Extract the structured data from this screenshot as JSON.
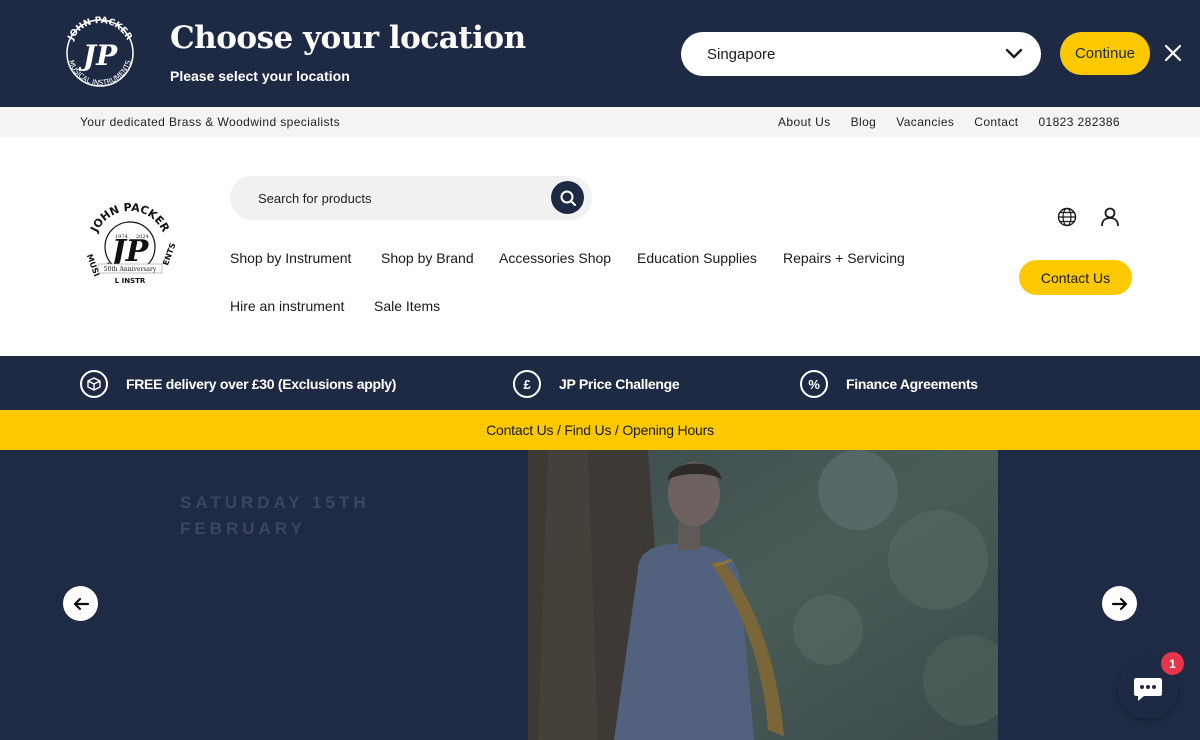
{
  "location_banner": {
    "title": "Choose your location",
    "subtitle": "Please select your location",
    "selected_location": "Singapore",
    "continue_label": "Continue",
    "logo_text_top": "JOHN PACKER",
    "logo_text_bottom": "MUSICAL INSTRUMENTS",
    "logo_monogram": "JP"
  },
  "utility_bar": {
    "tagline": "Your dedicated Brass & Woodwind specialists",
    "links": [
      "About Us",
      "Blog",
      "Vacancies",
      "Contact",
      "01823 282386"
    ]
  },
  "header": {
    "search_placeholder": "Search for products",
    "nav": [
      "Shop by Instrument",
      "Shop by Brand",
      "Accessories Shop",
      "Education Supplies",
      "Repairs + Servicing",
      "Hire an instrument",
      "Sale Items"
    ],
    "contact_label": "Contact Us",
    "logo": {
      "top": "JOHN PACKER",
      "monogram": "JP",
      "year_left": "1974",
      "year_right": "2024",
      "anniversary": "50th Anniversary",
      "side_left": "MUSI",
      "side_right": "ENTS",
      "bottom": "L INSTR"
    }
  },
  "usp_bar": {
    "items": [
      {
        "icon": "package-icon",
        "label": "FREE delivery over £30 (Exclusions apply)"
      },
      {
        "icon": "pound-icon",
        "glyph": "£",
        "label": "JP Price Challenge"
      },
      {
        "icon": "percent-icon",
        "glyph": "%",
        "label": "Finance Agreements"
      }
    ]
  },
  "yellow_strip": {
    "text": "Contact Us / Find Us / Opening Hours"
  },
  "hero": {
    "date_line1": "SATURDAY 15TH",
    "date_line2": "FEBRUARY"
  },
  "chat": {
    "badge_count": "1"
  },
  "colors": {
    "navy": "#1e2a44",
    "yellow": "#fcc900",
    "badge_red": "#e8334b"
  }
}
